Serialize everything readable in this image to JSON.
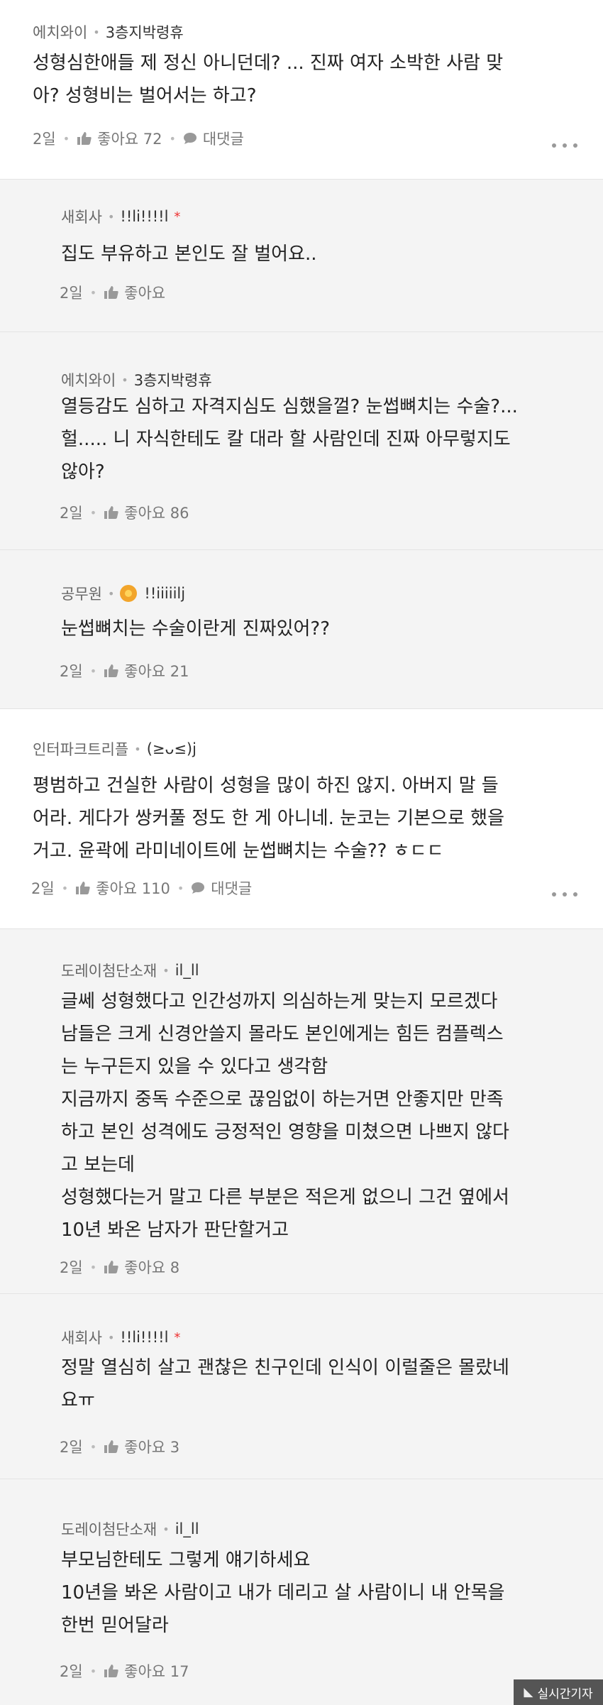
{
  "comments": [
    {
      "name": "에치와이",
      "grade": "3층지박령휴",
      "text": "성형심한애들 제 정신 아니던데? ... 진짜 여자 소박한 사람 맞\n아? 성형비는 벌어서는 하고?",
      "time": "2일",
      "likes": "좋아요 72",
      "reply_label": "대댓글"
    },
    {
      "name": "새회사",
      "grade": "!!li!!!!l",
      "star": "*",
      "text": "집도 부유하고 본인도 잘 벌어요..",
      "time": "2일",
      "likes": "좋아요"
    },
    {
      "name": "에치와이",
      "grade": "3층지박령휴",
      "text": "열등감도 심하고 자격지심도 심했을껄? 눈썹뼈치는 수술?...\n헐..... 니 자식한테도 칼 대라 할 사람인데 진짜 아무렇지도\n않아?",
      "time": "2일",
      "likes": "좋아요 86"
    },
    {
      "name": "공무원",
      "grade": "!!iiiiilj",
      "text": "눈썹뼈치는 수술이란게 진짜있어??",
      "time": "2일",
      "likes": "좋아요 21"
    },
    {
      "name": "인터파크트리플",
      "grade": "(≥ᴗ≤)j",
      "text": "평범하고 건실한 사람이 성형을 많이 하진 않지. 아버지 말 들\n어라. 게다가 쌍커풀 정도 한 게 아니네. 눈코는 기본으로 했을\n거고. 윤곽에 라미네이트에 눈썹뼈치는 수술?? ㅎㄷㄷ",
      "time": "2일",
      "likes": "좋아요 110",
      "reply_label": "대댓글"
    },
    {
      "name": "도레이첨단소재",
      "grade": "il_ll",
      "text": "글쎄 성형했다고 인간성까지 의심하는게 맞는지 모르겠다\n남들은 크게 신경안쓸지 몰라도 본인에게는 힘든 컴플렉스\n는 누구든지 있을 수 있다고 생각함\n지금까지 중독 수준으로 끊임없이 하는거면 안좋지만 만족\n하고 본인 성격에도 긍정적인 영향을 미쳤으면 나쁘지 않다\n고 보는데\n성형했다는거 말고 다른 부분은 적은게 없으니 그건 옆에서\n10년 봐온 남자가 판단할거고",
      "time": "2일",
      "likes": "좋아요 8"
    },
    {
      "name": "새회사",
      "grade": "!!li!!!!l",
      "star": "*",
      "text": "정말 열심히 살고 괜찮은 친구인데 인식이 이럴줄은 몰랐네\n요ㅠ",
      "time": "2일",
      "likes": "좋아요 3"
    },
    {
      "name": "도레이첨단소재",
      "grade": "il_ll",
      "text": "부모님한테도 그렇게 얘기하세요\n10년을 봐온 사람이고 내가 데리고 살 사람이니 내 안목을\n한번 믿어달라",
      "time": "2일",
      "likes": "좋아요 17"
    }
  ],
  "watermark": "실시간기자",
  "colors": {
    "reply_bg": "#f4f4f4",
    "star": "#ee3333",
    "badge": "#f2a52b"
  }
}
